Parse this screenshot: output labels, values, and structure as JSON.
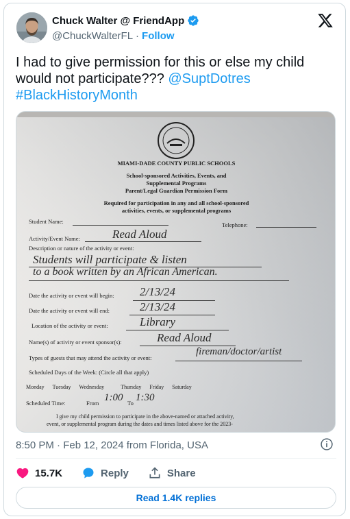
{
  "author": {
    "display_name": "Chuck Walter @ FriendApp",
    "handle": "@ChuckWalterFL",
    "separator": "·",
    "follow_label": "Follow"
  },
  "tweet": {
    "text_part1": "I had to give permission for this or else my child would not participate??? ",
    "mention": "@SuptDotres",
    "hashtag": "#BlackHistoryMonth"
  },
  "form": {
    "school": "MIAMI-DADE COUNTY PUBLIC SCHOOLS",
    "heading1": "School-sponsored Activities, Events, and",
    "heading2": "Supplemental Programs",
    "heading3": "Parent/Legal Guardian Permission Form",
    "required1": "Required for participation in any and all school-sponsored",
    "required2": "activities, events, or supplemental programs",
    "student_name_label": "Student Name:",
    "telephone_label": "Telephone:",
    "activity_label": "Activity/Event Name:",
    "activity_value": "Read Aloud",
    "description_label": "Description or nature of the activity or event:",
    "description_line1": "Students will participate & listen",
    "description_line2": "to a book written by an African American.",
    "begin_label": "Date the activity or event will begin:",
    "begin_value": "2/13/24",
    "end_label": "Date the activity or event will end:",
    "end_value": "2/13/24",
    "location_label": "Location of the activity or event:",
    "location_value": "Library",
    "sponsor_label": "Name(s) of activity or event sponsor(s):",
    "sponsor_value": "Read Aloud",
    "guests_label": "Types of guests that may attend the activity or event:",
    "guests_value": "fireman/doctor/artist",
    "days_label": "Scheduled Days of the Week: (Circle all that apply)",
    "days": [
      "Monday",
      "Tuesday",
      "Wednesday",
      "Thursday",
      "Friday",
      "Saturday"
    ],
    "time_label": "Scheduled Time:",
    "time_from_label": "From",
    "time_from_value": "1:00",
    "time_to_label": "To",
    "time_to_value": "1:30",
    "consent1": "I give my child permission to participate in the above-named or attached activity,",
    "consent2": "event, or supplemental program during the dates and times listed above for the 2023-"
  },
  "meta": {
    "timestamp": "8:50 PM · Feb 12, 2024 from Florida, USA"
  },
  "actions": {
    "likes": "15.7K",
    "reply_label": "Reply",
    "share_label": "Share"
  },
  "replies_button": "Read 1.4K replies",
  "colors": {
    "accent": "#1d9bf0",
    "like": "#f91880",
    "text": "#0f1419",
    "muted": "#536471"
  }
}
